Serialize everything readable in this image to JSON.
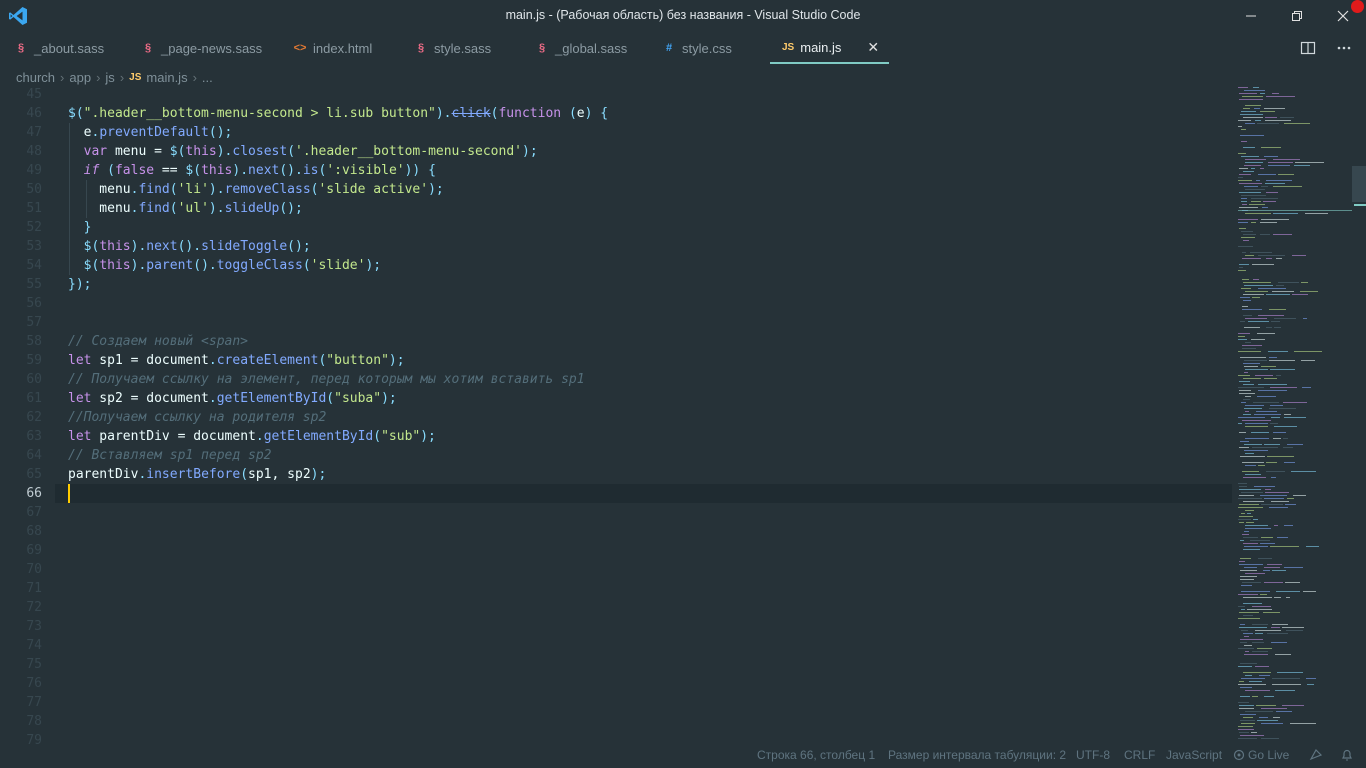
{
  "window": {
    "title": "main.js - (Рабочая область) без названия - Visual Studio Code"
  },
  "tabs": [
    {
      "label": "_about.sass",
      "icon": "sass-icon",
      "active": false
    },
    {
      "label": "_page-news.sass",
      "icon": "sass-icon",
      "active": false
    },
    {
      "label": "index.html",
      "icon": "html-icon",
      "active": false
    },
    {
      "label": "style.sass",
      "icon": "sass-icon",
      "active": false
    },
    {
      "label": "_global.sass",
      "icon": "sass-icon",
      "active": false
    },
    {
      "label": "style.css",
      "icon": "css-icon",
      "active": false
    },
    {
      "label": "main.js",
      "icon": "js-icon",
      "active": true
    }
  ],
  "tab_icons": {
    "sass": "§",
    "html": "<>",
    "css": "#",
    "js": "JS"
  },
  "breadcrumb": {
    "items": [
      "church",
      "app",
      "js",
      "main.js",
      "..."
    ],
    "js_badge": "JS"
  },
  "editor": {
    "current_line": 66,
    "line_numbers": [
      "45",
      "46",
      "47",
      "48",
      "49",
      "50",
      "51",
      "52",
      "53",
      "54",
      "55",
      "56",
      "57",
      "58",
      "59",
      "60",
      "61",
      "62",
      "63",
      "64",
      "65",
      "66",
      "67",
      "68",
      "69",
      "70",
      "71",
      "72",
      "73",
      "74",
      "75",
      "76",
      "77",
      "78",
      "79"
    ]
  },
  "statusbar": {
    "position": "Строка 66, столбец 1",
    "indent": "Размер интервала табуляции: 2",
    "encoding": "UTF-8",
    "eol": "CRLF",
    "language": "JavaScript",
    "golive": "Go Live"
  },
  "colors": {
    "background": "#263238",
    "accent": "#80cbc4",
    "keyword": "#c792ea",
    "string": "#c3e88d",
    "function": "#82aaff",
    "punctuation": "#89ddff",
    "comment": "#546e7a",
    "sass_icon": "#ec6b86",
    "html_icon": "#e37933",
    "css_icon": "#42a5f5",
    "js_icon": "#ffcb6b"
  }
}
